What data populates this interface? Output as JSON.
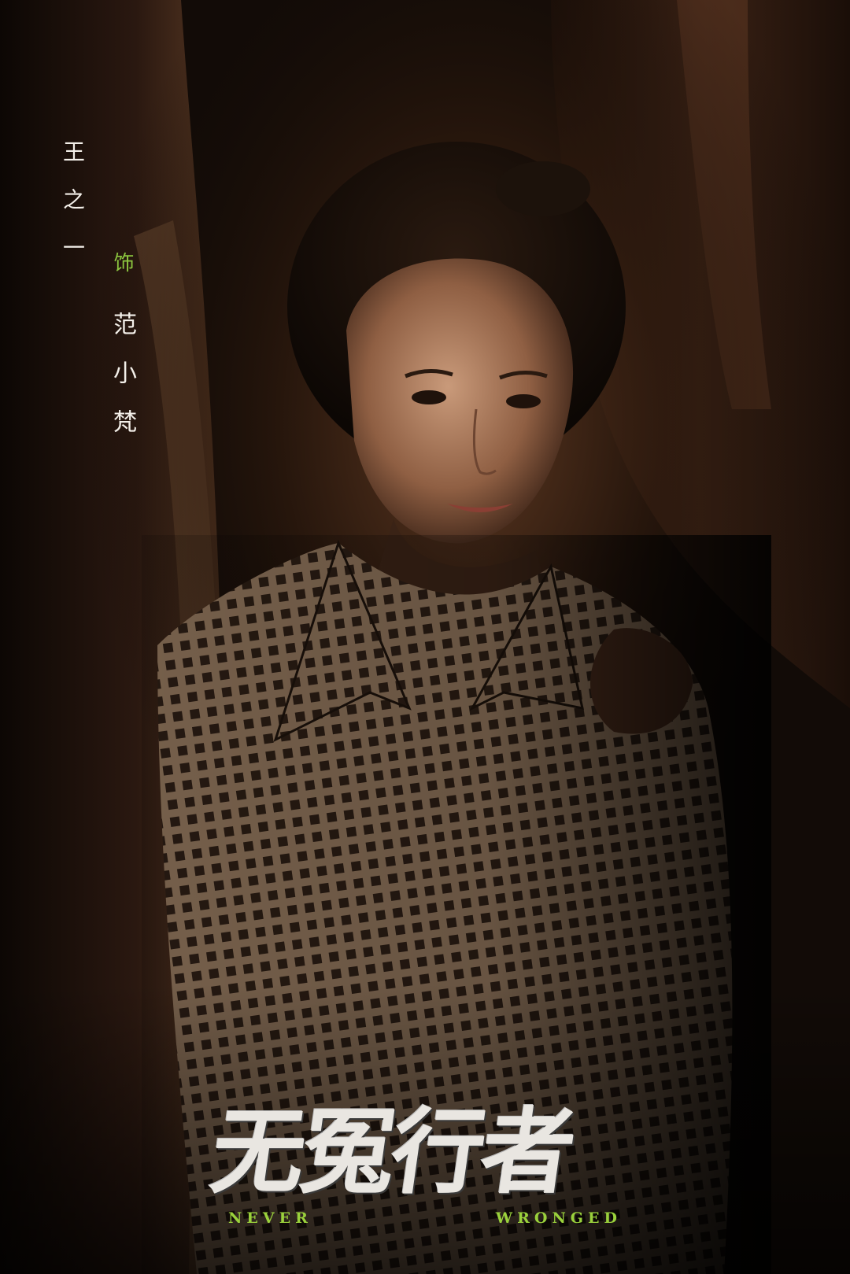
{
  "character": {
    "name": "王之一",
    "role_marker": "饰",
    "actor": "范小梵"
  },
  "title": {
    "chinese": "无冤行者",
    "english": "NEVER WRONGED"
  },
  "colors": {
    "accent": "#8cc63f",
    "text": "#f3efe9",
    "background": "#120b07"
  }
}
